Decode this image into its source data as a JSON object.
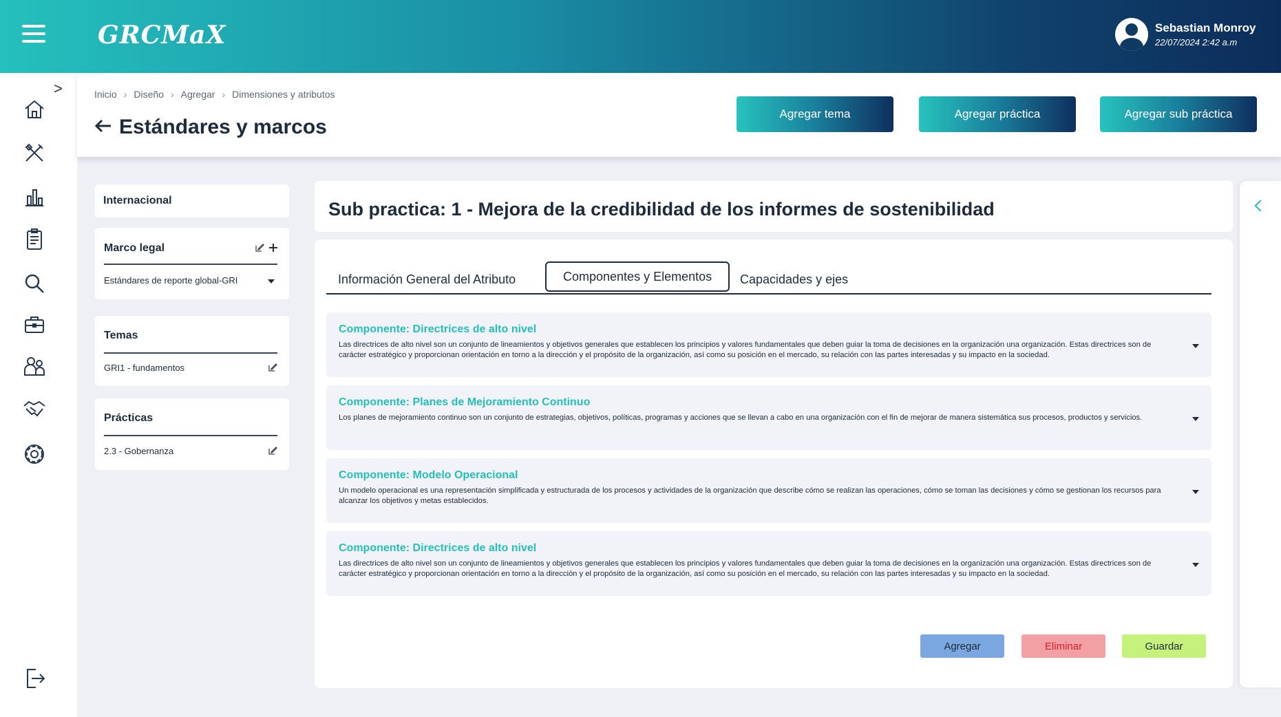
{
  "header": {
    "logo": "GRCMaX",
    "user_name": "Sebastian Monroy",
    "user_datetime": "22/07/2024 2:42 a.m"
  },
  "breadcrumb": [
    "Inicio",
    "Diseño",
    "Agregar",
    "Dimensiones y atributos"
  ],
  "page_title": "Estándares y marcos",
  "header_buttons": {
    "add_topic": "Agregar tema",
    "add_practice": "Agregar práctica",
    "add_subpractice": "Agregar sub práctica"
  },
  "left_panel": {
    "internacional": "Internacional",
    "marco_legal": {
      "title": "Marco legal",
      "selected": "Estándares de reporte global-GRI"
    },
    "temas": {
      "title": "Temas",
      "item": "GRI1 - fundamentos"
    },
    "practicas": {
      "title": "Prácticas",
      "item": "2.3 - Gobernanza"
    }
  },
  "main": {
    "title": "Sub practica: 1   -   Mejora de la credibilidad de los informes de sostenibilidad",
    "tabs": [
      "Información General del Atributo",
      "Componentes y Elementos",
      "Capacidades y ejes"
    ],
    "components": [
      {
        "title": "Componente: Directrices de alto nivel",
        "desc": "Las directrices de alto nivel son un conjunto de lineamientos y objetivos generales que establecen los principios y valores fundamentales que deben guiar la toma de decisiones en la organización una organización. Estas directrices son de carácter estratégico y proporcionan orientación en torno a la dirección y el propósito de la organización, así como su posición en el mercado, su relación con las partes interesadas y su impacto en la sociedad."
      },
      {
        "title": "Componente: Planes de Mejoramiento Continuo",
        "desc": "Los planes de mejoramiento continuo son un conjunto de estrategias, objetivos, políticas, programas y acciones que se llevan a cabo en una organización con el fin de mejorar de manera sistemática sus procesos, productos y servicios."
      },
      {
        "title": "Componente: Modelo Operacional",
        "desc": "Un modelo operacional es una representación simplificada y estructurada de los procesos y actividades de la organización que describe cómo se realizan las operaciones, cómo se toman las decisiones y cómo se gestionan los recursos para alcanzar los objetivos y metas establecidos."
      },
      {
        "title": "Componente: Directrices de alto nivel",
        "desc": "Las directrices de alto nivel son un conjunto de lineamientos y objetivos generales que establecen los principios y valores fundamentales que deben guiar la toma de decisiones en la organización una organización. Estas directrices son de carácter estratégico y proporcionan orientación en torno a la dirección y el propósito de la organización, así como su posición en el mercado, su relación con las partes interesadas y su impacto en la sociedad."
      }
    ],
    "actions": {
      "add": "Agregar",
      "delete": "Eliminar",
      "save": "Guardar"
    }
  },
  "colors": {
    "accent_teal": "#25bfb8",
    "navy": "#0f2f5e",
    "add_button": "#7aa7e0",
    "delete_button": "#f2a0a3",
    "save_button": "#c4f27d",
    "delete_text": "#d91f2a"
  },
  "icons": {
    "nav": [
      "home-icon",
      "design-tools-icon",
      "bar-chart-icon",
      "clipboard-icon",
      "search-icon",
      "briefcase-icon",
      "users-icon",
      "handshake-icon",
      "gear-icon",
      "logout-icon"
    ]
  }
}
